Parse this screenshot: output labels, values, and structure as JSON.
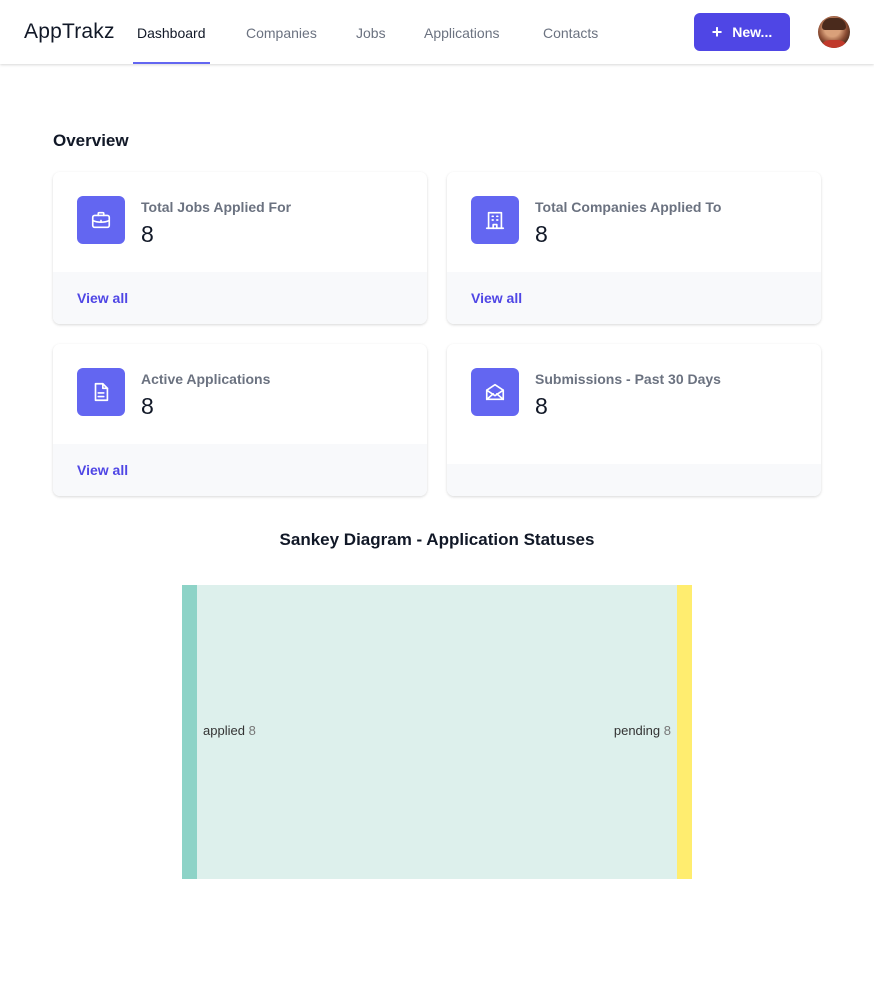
{
  "app": {
    "brand": "AppTrakz"
  },
  "nav": {
    "items": [
      {
        "label": "Dashboard",
        "active": true
      },
      {
        "label": "Companies",
        "active": false
      },
      {
        "label": "Jobs",
        "active": false
      },
      {
        "label": "Applications",
        "active": false
      },
      {
        "label": "Contacts",
        "active": false
      }
    ],
    "new_button": "New..."
  },
  "overview": {
    "title": "Overview",
    "cards": [
      {
        "icon": "briefcase-icon",
        "label": "Total Jobs Applied For",
        "value": "8",
        "link": "View all"
      },
      {
        "icon": "building-icon",
        "label": "Total Companies Applied To",
        "value": "8",
        "link": "View all"
      },
      {
        "icon": "document-icon",
        "label": "Active Applications",
        "value": "8",
        "link": "View all"
      },
      {
        "icon": "envelope-open-icon",
        "label": "Submissions - Past 30 Days",
        "value": "8",
        "link": ""
      }
    ]
  },
  "sankey": {
    "title": "Sankey Diagram - Application Statuses",
    "nodes": [
      {
        "name": "applied",
        "value": "8",
        "color": "#8dd3c7"
      },
      {
        "name": "pending",
        "value": "8",
        "color": "#ffed6f"
      }
    ],
    "links": [
      {
        "source": "applied",
        "target": "pending",
        "value": 8
      }
    ]
  },
  "colors": {
    "accent": "#6366f1",
    "button": "#4f46e5",
    "link_text": "#4f46e5"
  }
}
